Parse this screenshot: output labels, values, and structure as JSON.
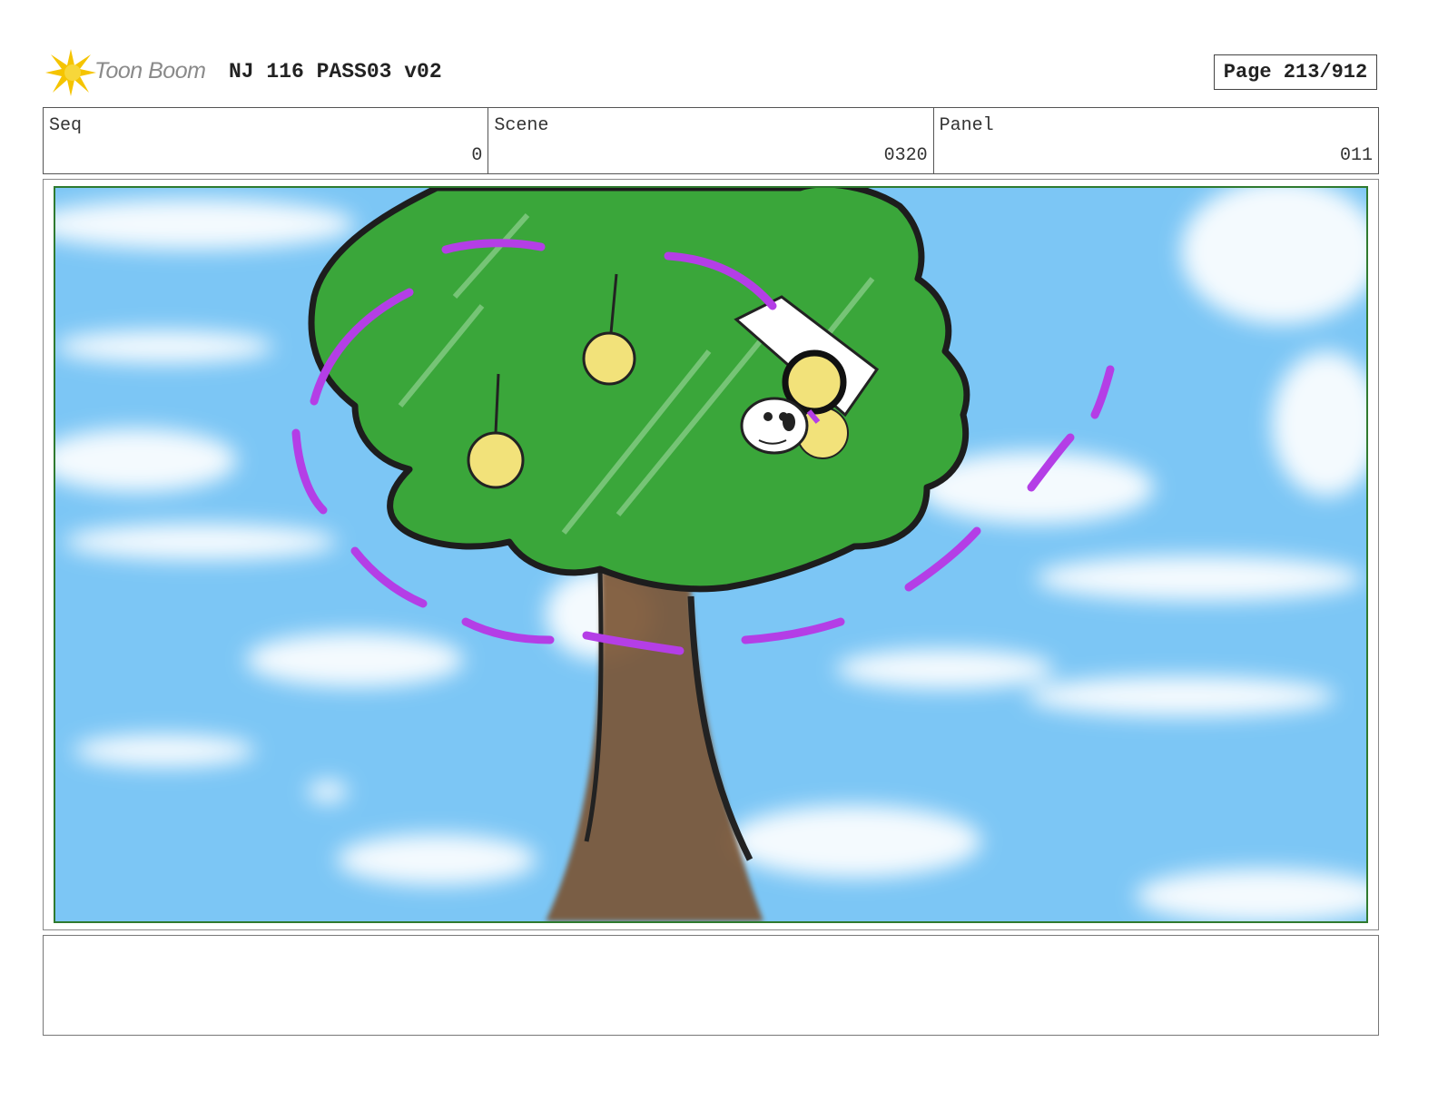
{
  "header": {
    "logo_text": "Toon Boom",
    "title": "NJ 116 PASS03 v02",
    "page": "Page 213/912"
  },
  "info": {
    "seq_label": "Seq",
    "seq_value": "0",
    "scene_label": "Scene",
    "scene_value": "0320",
    "panel_label": "Panel",
    "panel_value": "011"
  },
  "notes": {
    "text": ""
  },
  "colors": {
    "sky": "#7cc6f5",
    "leaves": "#3aa63a",
    "trunk": "#7a5230",
    "fruit": "#f2e27a",
    "motion": "#b43ee6",
    "frame": "#2f7a2f"
  }
}
